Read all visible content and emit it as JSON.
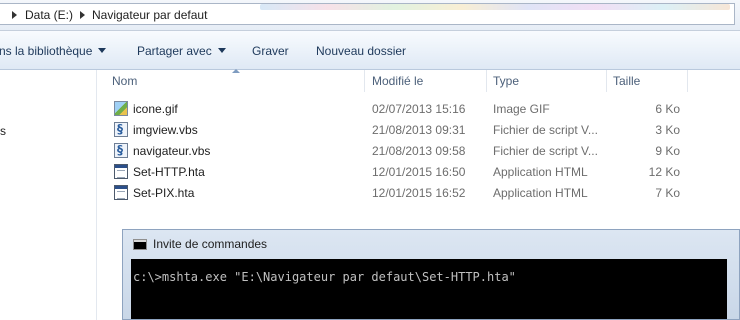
{
  "address": {
    "crumbs": [
      "Data (E:)",
      "Navigateur par defaut"
    ]
  },
  "toolbar": {
    "library_label": "ns la bibliothèque",
    "share_label": "Partager avec",
    "burn_label": "Graver",
    "new_folder_label": "Nouveau dossier"
  },
  "nav": {
    "partial_label": "s"
  },
  "columns": {
    "name": "Nom",
    "modified": "Modifié le",
    "type": "Type",
    "size": "Taille"
  },
  "files": [
    {
      "name": "icone.gif",
      "modified": "02/07/2013 15:16",
      "type": "Image GIF",
      "size": "6 Ko",
      "icon": "gif-image-icon"
    },
    {
      "name": "imgview.vbs",
      "modified": "21/08/2013 09:31",
      "type": "Fichier de script V...",
      "size": "3 Ko",
      "icon": "vbs-script-icon"
    },
    {
      "name": "navigateur.vbs",
      "modified": "21/08/2013 09:58",
      "type": "Fichier de script V...",
      "size": "9 Ko",
      "icon": "vbs-script-icon"
    },
    {
      "name": "Set-HTTP.hta",
      "modified": "12/01/2015 16:50",
      "type": "Application HTML",
      "size": "12 Ko",
      "icon": "hta-application-icon"
    },
    {
      "name": "Set-PIX.hta",
      "modified": "12/01/2015 16:52",
      "type": "Application HTML",
      "size": "7 Ko",
      "icon": "hta-application-icon"
    }
  ],
  "cmd": {
    "title": "Invite de commandes",
    "command_line": "c:\\>mshta.exe \"E:\\Navigateur par defaut\\Set-HTTP.hta\""
  },
  "colors": {
    "console_bg": "#000000",
    "console_text": "#c0c0c0",
    "toolbar_text": "#1e395b"
  }
}
